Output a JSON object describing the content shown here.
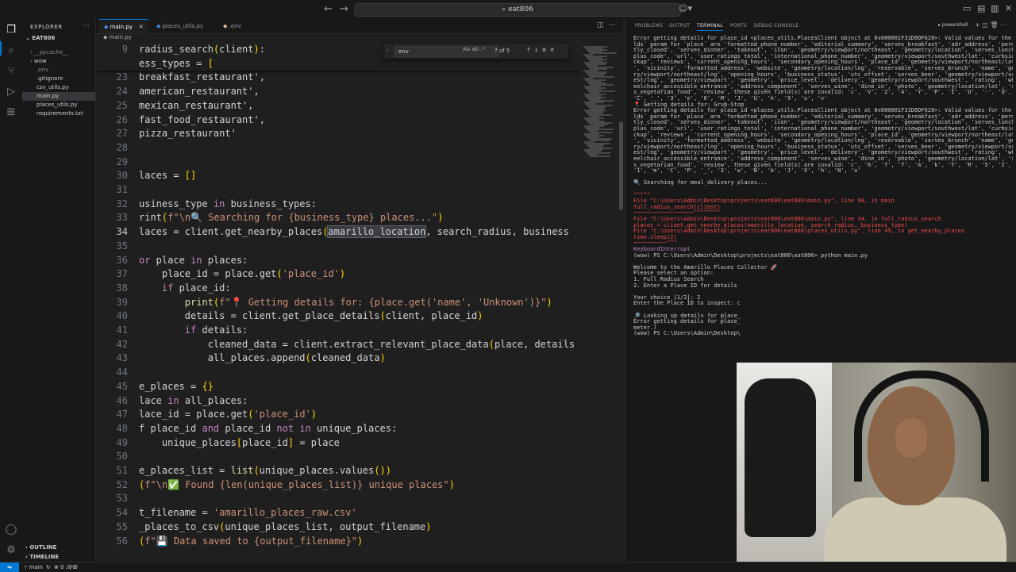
{
  "titlebar": {
    "search": "eat806"
  },
  "explorer": {
    "header": "EXPLORER",
    "root": "EAT806",
    "items": [
      {
        "label": "__pycache__",
        "folder": true,
        "state": "dim"
      },
      {
        "label": "wow",
        "folder": true,
        "state": "normal"
      },
      {
        "label": ".env",
        "folder": false,
        "state": "dim"
      },
      {
        "label": ".gitignore",
        "folder": false,
        "state": "normal"
      },
      {
        "label": "csv_utils.py",
        "folder": false,
        "state": "normal"
      },
      {
        "label": "main.py",
        "folder": false,
        "state": "selected"
      },
      {
        "label": "places_utils.py",
        "folder": false,
        "state": "normal"
      },
      {
        "label": "requirements.txt",
        "folder": false,
        "state": "normal"
      }
    ],
    "outline": "OUTLINE",
    "timeline": "TIMELINE"
  },
  "tabs": [
    {
      "label": "main.py",
      "active": true
    },
    {
      "label": "places_utils.py",
      "active": false
    },
    {
      "label": ".env",
      "active": false
    }
  ],
  "breadcrumb": "main.py",
  "find": {
    "query": "env",
    "count": "? of 5"
  },
  "code": [
    {
      "n": "9",
      "sticky": true,
      "t": "radius_search(client):"
    },
    {
      "n": "",
      "sticky": true,
      "t": "ess_types = ["
    },
    {
      "n": "23",
      "t": "breakfast_restaurant',"
    },
    {
      "n": "24",
      "t": "american_restaurant',"
    },
    {
      "n": "25",
      "t": "mexican_restaurant',"
    },
    {
      "n": "26",
      "t": "fast_food_restaurant',"
    },
    {
      "n": "27",
      "t": "pizza_restaurant'"
    },
    {
      "n": "28",
      "t": ""
    },
    {
      "n": "29",
      "t": ""
    },
    {
      "n": "30",
      "t": "laces = []"
    },
    {
      "n": "31",
      "t": ""
    },
    {
      "n": "32",
      "t": "usiness_type in business_types:"
    },
    {
      "n": "33",
      "t": "rint(f\"\\n🔍 Searching for {business_type} places...\")"
    },
    {
      "n": "34",
      "t": "laces = client.get_nearby_places(amarillo_location, search_radius, business",
      "cur": true
    },
    {
      "n": "35",
      "t": ""
    },
    {
      "n": "36",
      "t": "or place in places:"
    },
    {
      "n": "37",
      "t": "    place_id = place.get('place_id')"
    },
    {
      "n": "38",
      "t": "    if place_id:"
    },
    {
      "n": "39",
      "t": "        print(f\"📍 Getting details for: {place.get('name', 'Unknown')}\")"
    },
    {
      "n": "40",
      "t": "        details = client.get_place_details(client, place_id)"
    },
    {
      "n": "41",
      "t": "        if details:"
    },
    {
      "n": "42",
      "t": "            cleaned_data = client.extract_relevant_place_data(place, details"
    },
    {
      "n": "43",
      "t": "            all_places.append(cleaned_data)"
    },
    {
      "n": "44",
      "t": ""
    },
    {
      "n": "45",
      "t": "e_places = {}"
    },
    {
      "n": "46",
      "t": "lace in all_places:"
    },
    {
      "n": "47",
      "t": "lace_id = place.get('place_id')"
    },
    {
      "n": "48",
      "t": "f place_id and place_id not in unique_places:"
    },
    {
      "n": "49",
      "t": "    unique_places[place_id] = place"
    },
    {
      "n": "50",
      "t": ""
    },
    {
      "n": "51",
      "t": "e_places_list = list(unique_places.values())"
    },
    {
      "n": "52",
      "t": "(f\"\\n✅ Found {len(unique_places_list)} unique places\")"
    },
    {
      "n": "53",
      "t": ""
    },
    {
      "n": "54",
      "t": "t_filename = 'amarillo_places_raw.csv'"
    },
    {
      "n": "55",
      "t": "_places_to_csv(unique_places_list, output_filename)"
    },
    {
      "n": "56",
      "t": "(f\"💾 Data saved to {output_filename}\")"
    }
  ],
  "panel": {
    "tabs": [
      "PROBLEMS",
      "OUTPUT",
      "TERMINAL",
      "PORTS",
      "DEBUG CONSOLE"
    ],
    "active_tab": "TERMINAL",
    "shell": "powershell"
  },
  "terminal": [
    {
      "c": "err",
      "t": "Error getting details for place_id <places_utils.PlacesClient object at 0x000001F31D6DF620>: Valid values for the `fie"
    },
    {
      "c": "err",
      "t": "lds` param for `place` are 'formatted_phone_number', 'editorial_summary', 'serves_breakfast', 'adr_address', 'permanen"
    },
    {
      "c": "err",
      "t": "tly_closed', 'serves_dinner', 'takeout', 'icon', 'geometry/viewport/northeast', 'geometry/location', 'serves_lunch', '"
    },
    {
      "c": "err",
      "t": "plus_code', 'url', 'user_ratings_total', 'international_phone_number', 'geometry/viewport/southwest/lat', 'curbside_pi"
    },
    {
      "c": "err",
      "t": "ckup', 'reviews', 'current_opening_hours', 'secondary_opening_hours', 'place_id', 'geometry/viewport/northeast/lat', 'type"
    },
    {
      "c": "err",
      "t": "', 'vicinity', 'formatted_address', 'website', 'geometry/location/lng', 'reservable', 'serves_brunch', 'name', 'geomet"
    },
    {
      "c": "err",
      "t": "ry/viewport/northeast/lng', 'opening_hours', 'business_status', 'utc_offset', 'serves_beer', 'geometry/viewport/southw"
    },
    {
      "c": "err",
      "t": "est/lng', 'geometry/viewport', 'geometry', 'price_level', 'delivery', 'geometry/viewport/southwest', 'rating', 'wh"
    },
    {
      "c": "err",
      "t": "eelchair_accessible_entrance', 'address_component', 'serves_wine', 'dine_in', 'photo', 'geometry/location/lat', 'serve"
    },
    {
      "c": "err",
      "t": "s_vegetarian_food', 'review', these given field(s) are invalid: 'c', 'V', '2', 'A', 'Y', 'P', 'I', 'U', '-', 'Q', '1', '"
    },
    {
      "c": "err",
      "t": "'C', '_', '3', 'e', 'O', 'M', 'J', 'U', 'h', '9', 'u', 'v'"
    },
    {
      "c": "err",
      "t": "📍 Getting details for: Grub-Stop"
    },
    {
      "c": "err",
      "t": "Error getting details for place_id <places_utils.PlacesClient object at 0x000001F31D6DF620>: Valid values for the `fie"
    },
    {
      "c": "err",
      "t": "lds` param for `place` are 'formatted_phone_number', 'editorial_summary', 'serves_breakfast', 'adr_address', 'permanen"
    },
    {
      "c": "err",
      "t": "tly_closed', 'serves_dinner', 'takeout', 'icon', 'geometry/viewport/northeast', 'geometry/location', 'serves_lunch', '"
    },
    {
      "c": "err",
      "t": "plus_code', 'url', 'user_ratings_total', 'international_phone_number', 'geometry/viewport/southwest/lat', 'curbside_pi"
    },
    {
      "c": "err",
      "t": "ckup', 'reviews', 'current_opening_hours', 'secondary_opening_hours', 'place_id', 'geometry/viewport/northeast/lat', 'type"
    },
    {
      "c": "err",
      "t": "', 'vicinity', 'formatted_address', 'website', 'geometry/location/lng', 'reservable', 'serves_brunch', 'name', 'geomet"
    },
    {
      "c": "err",
      "t": "ry/viewport/northeast/lng', 'opening_hours', 'business_status', 'utc_offset', 'serves_beer', 'geometry/viewport/southw"
    },
    {
      "c": "err",
      "t": "est/lng', 'geometry/viewport', 'geometry', 'price_level', 'delivery', 'geometry/viewport/southwest', 'rating', 'wh"
    },
    {
      "c": "err",
      "t": "eelchair_accessible_entrance', 'address_component', 'serves_wine', 'dine_in', 'photo', 'geometry/location/lat', 'serve"
    },
    {
      "c": "err",
      "t": "s_vegetarian_food', 'review', these given field(s) are invalid: 'c', '6', 'f', '7', 'A', 'k', 'Y', 'R', '5', 'I', 'W', '"
    },
    {
      "c": "err",
      "t": "'1', 'm', 'C', 'P', '_', '3', 'w', 'B', 'b', 'J', 'X', 'h', 'N', 'o'"
    },
    {
      "c": "err",
      "t": ""
    },
    {
      "c": "err",
      "t": "🔍 Searching for meal_delivery places..."
    },
    {
      "c": "err",
      "t": ""
    },
    {
      "c": "red",
      "t": "  ^^^^^"
    },
    {
      "c": "red",
      "t": "  File \"C:\\Users\\Admin\\Desktop\\projects\\eat806\\eat806\\main.py\", line 98, in main"
    },
    {
      "c": "red",
      "t": "    full_radius_search(client)"
    },
    {
      "c": "red",
      "t": "    ~~~~~~~~~~~~~~~~~~^^^^^^^^"
    },
    {
      "c": "red",
      "t": "  File \"C:\\Users\\Admin\\Desktop\\projects\\eat806\\eat806\\main.py\", line 34, in full_radius_search"
    },
    {
      "c": "red",
      "t": "    places = client.get_nearby_places(amarillo_location, search_radius, business_type)"
    },
    {
      "c": "red",
      "t": "  File \"C:\\Users\\Admin\\Desktop\\projects\\eat806\\eat806\\places_utils.py\", line 49, in get_nearby_places"
    },
    {
      "c": "red",
      "t": "    time.sleep(2)"
    },
    {
      "c": "red",
      "t": "    ~~~~~~~~~~^^^"
    },
    {
      "c": "purple",
      "t": "KeyboardInterrupt"
    },
    {
      "c": "err",
      "t": "(wow) PS C:\\Users\\Admin\\Desktop\\projects\\eat806\\eat806> python main.py"
    },
    {
      "c": "err",
      "t": ""
    },
    {
      "c": "err",
      "t": "Welcome to the Amarillo Places Collector 🚀"
    },
    {
      "c": "err",
      "t": "Please select an option:"
    },
    {
      "c": "err",
      "t": "1. Full Radius Search"
    },
    {
      "c": "err",
      "t": "2. Enter a Place ID for details"
    },
    {
      "c": "err",
      "t": ""
    },
    {
      "c": "err",
      "t": "Your choice [1/2]: 2"
    },
    {
      "c": "err",
      "t": "Enter the Place ID to inspect: c"
    },
    {
      "c": "err",
      "t": ""
    },
    {
      "c": "err",
      "t": "🔎 Looking up details for place_"
    },
    {
      "c": "err",
      "t": "Error getting details for place_"
    },
    {
      "c": "err",
      "t": "meter.)"
    },
    {
      "c": "err",
      "t": "(wow) PS C:\\Users\\Admin\\Desktop\\"
    }
  ],
  "status": {
    "branch": "main",
    "problems": "⊗ 0 ⚠ 0",
    "ports": "0"
  }
}
